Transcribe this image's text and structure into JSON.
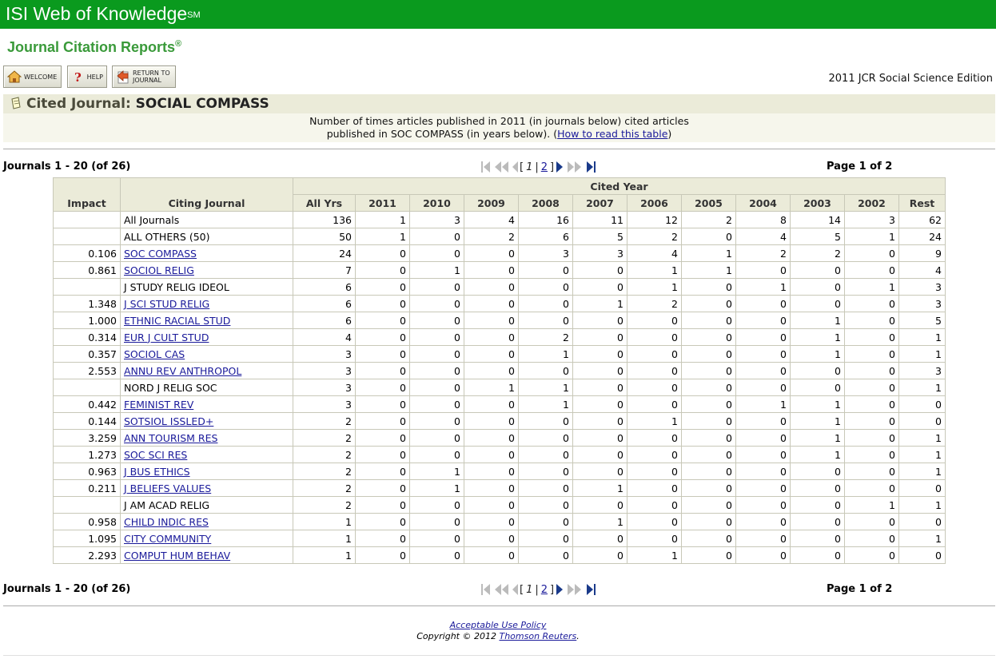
{
  "header": {
    "brand": "ISI Web of Knowledge",
    "brand_mark": "SM",
    "product": "Journal Citation Reports",
    "product_mark": "®",
    "edition": "2011 JCR Social Science Edition"
  },
  "nav": {
    "welcome": "WELCOME",
    "help": "HELP",
    "return_line1": "RETURN TO",
    "return_line2": "JOURNAL"
  },
  "cited": {
    "label": "Cited Journal:",
    "journal": "SOCIAL COMPASS",
    "desc_line1": "Number of times articles published in 2011 (in journals below) cited articles",
    "desc_line2_pre": "published in SOC COMPASS (in years below). (",
    "desc_link": "How to read this table",
    "desc_line2_post": ")"
  },
  "pagination": {
    "range": "Journals 1 - 20 (of 26)",
    "page_of": "Page 1 of 2",
    "open_bracket": "[",
    "current": "1",
    "sep": "|",
    "next": "2",
    "close_bracket": "]"
  },
  "table": {
    "header_impact": "Impact",
    "header_journal": "Citing Journal",
    "header_cited_year": "Cited Year",
    "years": [
      "All Yrs",
      "2011",
      "2010",
      "2009",
      "2008",
      "2007",
      "2006",
      "2005",
      "2004",
      "2003",
      "2002",
      "Rest"
    ],
    "rows": [
      {
        "impact": "",
        "journal": "All Journals",
        "link": false,
        "v": [
          "136",
          "1",
          "3",
          "4",
          "16",
          "11",
          "12",
          "2",
          "8",
          "14",
          "3",
          "62"
        ]
      },
      {
        "impact": "",
        "journal": "ALL OTHERS (50)",
        "link": false,
        "v": [
          "50",
          "1",
          "0",
          "2",
          "6",
          "5",
          "2",
          "0",
          "4",
          "5",
          "1",
          "24"
        ]
      },
      {
        "impact": "0.106",
        "journal": "SOC COMPASS",
        "link": true,
        "v": [
          "24",
          "0",
          "0",
          "0",
          "3",
          "3",
          "4",
          "1",
          "2",
          "2",
          "0",
          "9"
        ]
      },
      {
        "impact": "0.861",
        "journal": "SOCIOL RELIG",
        "link": true,
        "v": [
          "7",
          "0",
          "1",
          "0",
          "0",
          "0",
          "1",
          "1",
          "0",
          "0",
          "0",
          "4"
        ]
      },
      {
        "impact": "",
        "journal": "J STUDY RELIG IDEOL",
        "link": false,
        "v": [
          "6",
          "0",
          "0",
          "0",
          "0",
          "0",
          "1",
          "0",
          "1",
          "0",
          "1",
          "3"
        ]
      },
      {
        "impact": "1.348",
        "journal": "J SCI STUD RELIG",
        "link": true,
        "v": [
          "6",
          "0",
          "0",
          "0",
          "0",
          "1",
          "2",
          "0",
          "0",
          "0",
          "0",
          "3"
        ]
      },
      {
        "impact": "1.000",
        "journal": "ETHNIC RACIAL STUD",
        "link": true,
        "v": [
          "6",
          "0",
          "0",
          "0",
          "0",
          "0",
          "0",
          "0",
          "0",
          "1",
          "0",
          "5"
        ]
      },
      {
        "impact": "0.314",
        "journal": "EUR J CULT STUD",
        "link": true,
        "v": [
          "4",
          "0",
          "0",
          "0",
          "2",
          "0",
          "0",
          "0",
          "0",
          "1",
          "0",
          "1"
        ]
      },
      {
        "impact": "0.357",
        "journal": "SOCIOL CAS",
        "link": true,
        "v": [
          "3",
          "0",
          "0",
          "0",
          "1",
          "0",
          "0",
          "0",
          "0",
          "1",
          "0",
          "1"
        ]
      },
      {
        "impact": "2.553",
        "journal": "ANNU REV ANTHROPOL",
        "link": true,
        "v": [
          "3",
          "0",
          "0",
          "0",
          "0",
          "0",
          "0",
          "0",
          "0",
          "0",
          "0",
          "3"
        ]
      },
      {
        "impact": "",
        "journal": "NORD J RELIG SOC",
        "link": false,
        "v": [
          "3",
          "0",
          "0",
          "1",
          "1",
          "0",
          "0",
          "0",
          "0",
          "0",
          "0",
          "1"
        ]
      },
      {
        "impact": "0.442",
        "journal": "FEMINIST REV",
        "link": true,
        "v": [
          "3",
          "0",
          "0",
          "0",
          "1",
          "0",
          "0",
          "0",
          "1",
          "1",
          "0",
          "0"
        ]
      },
      {
        "impact": "0.144",
        "journal": "SOTSIOL ISSLED+",
        "link": true,
        "v": [
          "2",
          "0",
          "0",
          "0",
          "0",
          "0",
          "1",
          "0",
          "0",
          "1",
          "0",
          "0"
        ]
      },
      {
        "impact": "3.259",
        "journal": "ANN TOURISM RES",
        "link": true,
        "v": [
          "2",
          "0",
          "0",
          "0",
          "0",
          "0",
          "0",
          "0",
          "0",
          "1",
          "0",
          "1"
        ]
      },
      {
        "impact": "1.273",
        "journal": "SOC SCI RES",
        "link": true,
        "v": [
          "2",
          "0",
          "0",
          "0",
          "0",
          "0",
          "0",
          "0",
          "0",
          "1",
          "0",
          "1"
        ]
      },
      {
        "impact": "0.963",
        "journal": "J BUS ETHICS",
        "link": true,
        "v": [
          "2",
          "0",
          "1",
          "0",
          "0",
          "0",
          "0",
          "0",
          "0",
          "0",
          "0",
          "1"
        ]
      },
      {
        "impact": "0.211",
        "journal": "J BELIEFS VALUES",
        "link": true,
        "v": [
          "2",
          "0",
          "1",
          "0",
          "0",
          "1",
          "0",
          "0",
          "0",
          "0",
          "0",
          "0"
        ]
      },
      {
        "impact": "",
        "journal": "J AM ACAD RELIG",
        "link": false,
        "v": [
          "2",
          "0",
          "0",
          "0",
          "0",
          "0",
          "0",
          "0",
          "0",
          "0",
          "1",
          "1"
        ]
      },
      {
        "impact": "0.958",
        "journal": "CHILD INDIC RES",
        "link": true,
        "v": [
          "1",
          "0",
          "0",
          "0",
          "0",
          "1",
          "0",
          "0",
          "0",
          "0",
          "0",
          "0"
        ]
      },
      {
        "impact": "1.095",
        "journal": "CITY COMMUNITY",
        "link": true,
        "v": [
          "1",
          "0",
          "0",
          "0",
          "0",
          "0",
          "0",
          "0",
          "0",
          "0",
          "0",
          "1"
        ]
      },
      {
        "impact": "2.293",
        "journal": "COMPUT HUM BEHAV",
        "link": true,
        "v": [
          "1",
          "0",
          "0",
          "0",
          "0",
          "0",
          "1",
          "0",
          "0",
          "0",
          "0",
          "0"
        ]
      }
    ]
  },
  "footer": {
    "policy": "Acceptable Use Policy",
    "copyright_pre": "Copyright © 2012 ",
    "copyright_link": "Thomson Reuters",
    "copyright_post": "."
  },
  "colors": {
    "brand_green": "#0a9a1e",
    "title_green": "#3a9a3a",
    "band": "#ebebd9",
    "link": "#1a1a9a",
    "pager_blue": "#1a3a8a"
  },
  "icons": [
    "welcome-home-icon",
    "help-question-icon",
    "return-arrow-icon",
    "cited-note-icon",
    "first-page-icon",
    "prev-ten-icon",
    "prev-page-icon",
    "next-page-icon",
    "next-ten-icon",
    "last-page-icon"
  ]
}
